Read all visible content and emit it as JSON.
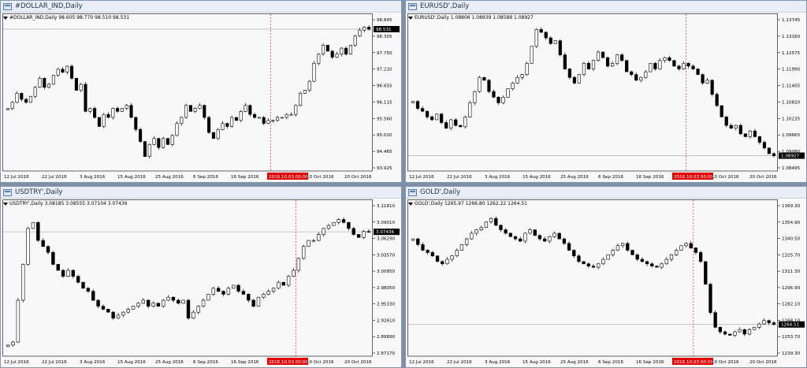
{
  "colors": {
    "bull": "#ffffff",
    "bear": "#000000",
    "wick": "#000000",
    "grid_bg": "#f8f8f8",
    "period_sep": "#e02020",
    "price_tag": "#000000",
    "current_line": "#b0b0b0",
    "time_tag": "#e00000"
  },
  "windows": [
    {
      "id": "dollar",
      "title": "#DOLLAR_IND,Daily",
      "info": "#DOLLAR_IND,Daily  98.605 98.770 98.510 98.531",
      "current_price": "98.531",
      "price_labels": [
        "98.845",
        "98.305",
        "97.750",
        "97.210",
        "96.655",
        "96.115",
        "95.560",
        "95.020",
        "94.465",
        "93.925"
      ],
      "date_labels": [
        "12 Jul 2016",
        "22 Jul 2016",
        "3 Aug 2016",
        "15 Aug 2016",
        "25 Aug 2016",
        "6 Sep 2016",
        "16 Sep 2016",
        "2016.10.03 00:00",
        "10 Oct 2016",
        "20 Oct 2016"
      ],
      "chart_data": {
        "type": "candlestick",
        "ylim": [
          93.925,
          98.845
        ],
        "current": 98.531,
        "separator_index": 58,
        "closes": [
          95.9,
          96.1,
          96.4,
          96.2,
          96.1,
          96.3,
          96.6,
          96.9,
          96.6,
          96.7,
          97.0,
          97.2,
          97.1,
          97.3,
          96.9,
          96.5,
          96.7,
          95.8,
          95.9,
          95.6,
          95.3,
          95.7,
          95.6,
          95.9,
          95.8,
          95.9,
          96.0,
          95.6,
          95.2,
          94.8,
          94.3,
          94.7,
          94.9,
          94.6,
          94.9,
          94.7,
          95.0,
          95.4,
          95.6,
          96.0,
          95.8,
          95.9,
          96.0,
          95.6,
          95.1,
          94.9,
          95.2,
          95.4,
          95.3,
          95.6,
          95.5,
          95.8,
          96.0,
          95.7,
          95.6,
          95.6,
          95.4,
          95.5,
          95.5,
          95.6,
          95.6,
          95.7,
          95.7,
          96.0,
          96.4,
          96.5,
          96.8,
          97.4,
          97.7,
          98.0,
          97.8,
          97.6,
          97.7,
          97.9,
          97.7,
          98.0,
          98.3,
          98.5,
          98.6,
          98.53
        ]
      }
    },
    {
      "id": "eurusd",
      "title": "EURUSD',Daily",
      "info": "EURUSD',Daily  1.08806 1.08939 1.08588 1.08927",
      "current_price": "1.08927",
      "price_labels": [
        "1.13745",
        "1.13160",
        "1.12575",
        "1.11990",
        "1.11405",
        "1.10820",
        "1.10235",
        "1.09665",
        "1.09080",
        "1.08495"
      ],
      "date_labels": [
        "12 Jul 2016",
        "22 Jul 2016",
        "3 Aug 2016",
        "15 Aug 2016",
        "25 Aug 2016",
        "6 Sep 2016",
        "16 Sep 2016",
        "2016.10.03 00:00",
        "10 Oct 2016",
        "20 Oct 2016"
      ],
      "chart_data": {
        "type": "candlestick",
        "ylim": [
          1.08495,
          1.13745
        ],
        "current": 1.08927,
        "separator_index": 58,
        "closes": [
          1.1085,
          1.106,
          1.105,
          1.103,
          1.102,
          1.104,
          1.101,
          1.099,
          1.102,
          1.1,
          1.0995,
          1.103,
          1.108,
          1.112,
          1.117,
          1.116,
          1.112,
          1.11,
          1.108,
          1.11,
          1.113,
          1.115,
          1.117,
          1.118,
          1.122,
          1.128,
          1.134,
          1.133,
          1.131,
          1.129,
          1.13,
          1.125,
          1.12,
          1.117,
          1.115,
          1.118,
          1.122,
          1.12,
          1.123,
          1.126,
          1.124,
          1.121,
          1.122,
          1.125,
          1.123,
          1.119,
          1.118,
          1.116,
          1.117,
          1.119,
          1.122,
          1.12,
          1.123,
          1.124,
          1.123,
          1.121,
          1.12,
          1.122,
          1.121,
          1.12,
          1.118,
          1.115,
          1.116,
          1.111,
          1.107,
          1.103,
          1.1,
          1.099,
          1.1,
          1.097,
          1.096,
          1.098,
          1.096,
          1.094,
          1.092,
          1.09,
          1.08927
        ]
      }
    },
    {
      "id": "usdtry",
      "title": "USDTRY',Daily",
      "info": "USDTRY',Daily  3.08185 3.08555 3.07104 3.07436",
      "current_price": "3.07436",
      "price_labels": [
        "3.11810",
        "3.09010",
        "3.06290",
        "3.03570",
        "3.00850",
        "2.98050",
        "2.95330",
        "2.92610",
        "2.89890",
        "2.87170"
      ],
      "date_labels": [
        "12 Jul 2016",
        "22 Jul 2016",
        "3 Aug 2016",
        "15 Aug 2016",
        "25 Aug 2016",
        "6 Sep 2016",
        "16 Sep 2016",
        "2016.10.03 00:00",
        "10 Oct 2016",
        "20 Oct 2016"
      ],
      "chart_data": {
        "type": "candlestick",
        "ylim": [
          2.8717,
          3.1181
        ],
        "current": 3.07436,
        "separator_index": 58,
        "closes": [
          2.885,
          2.89,
          2.96,
          3.02,
          3.08,
          3.09,
          3.06,
          3.05,
          3.04,
          3.02,
          3.01,
          3.0,
          3.01,
          3.0,
          2.99,
          2.98,
          2.975,
          2.96,
          2.95,
          2.945,
          2.94,
          2.93,
          2.935,
          2.94,
          2.945,
          2.95,
          2.955,
          2.96,
          2.95,
          2.955,
          2.95,
          2.96,
          2.965,
          2.96,
          2.955,
          2.96,
          2.93,
          2.94,
          2.95,
          2.96,
          2.97,
          2.98,
          2.975,
          2.97,
          2.98,
          2.985,
          2.975,
          2.97,
          2.96,
          2.95,
          2.965,
          2.97,
          2.975,
          2.98,
          2.99,
          2.985,
          3.0,
          3.01,
          3.03,
          3.05,
          3.06,
          3.06,
          3.07,
          3.08,
          3.085,
          3.09,
          3.095,
          3.09,
          3.08,
          3.07,
          3.065,
          3.075,
          3.074
        ]
      }
    },
    {
      "id": "gold",
      "title": "GOLD',Daily",
      "info": "GOLD',Daily  1265.97 1266.80 1262.22 1264.51",
      "current_price": "1264.51",
      "price_labels": [
        "1369.30",
        "1354.90",
        "1340.50",
        "1325.70",
        "1311.30",
        "1296.90",
        "1282.10",
        "1268.10",
        "1253.70",
        "1239.30"
      ],
      "date_labels": [
        "12 Jul 2016",
        "22 Jul 2016",
        "3 Aug 2016",
        "15 Aug 2016",
        "25 Aug 2016",
        "6 Sep 2016",
        "16 Sep 2016",
        "2016.10.03 00:00",
        "10 Oct 2016",
        "20 Oct 2016"
      ],
      "chart_data": {
        "type": "candlestick",
        "ylim": [
          1239.3,
          1369.3
        ],
        "current": 1264.51,
        "separator_index": 58,
        "closes": [
          1340,
          1335,
          1330,
          1328,
          1325,
          1320,
          1318,
          1322,
          1325,
          1330,
          1335,
          1340,
          1345,
          1348,
          1350,
          1355,
          1358,
          1352,
          1348,
          1345,
          1342,
          1340,
          1338,
          1345,
          1348,
          1343,
          1340,
          1338,
          1342,
          1345,
          1340,
          1336,
          1330,
          1325,
          1320,
          1318,
          1316,
          1315,
          1318,
          1322,
          1326,
          1330,
          1334,
          1336,
          1330,
          1326,
          1322,
          1320,
          1318,
          1316,
          1315,
          1318,
          1322,
          1326,
          1330,
          1334,
          1336,
          1332,
          1328,
          1320,
          1300,
          1275,
          1262,
          1258,
          1256,
          1255,
          1258,
          1260,
          1256,
          1260,
          1262,
          1265,
          1268,
          1266,
          1264.51
        ]
      }
    }
  ]
}
